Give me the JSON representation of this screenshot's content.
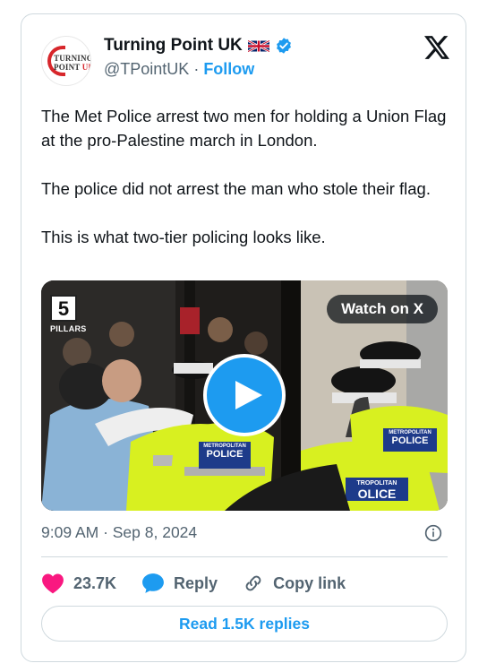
{
  "account": {
    "display_name": "Turning Point UK",
    "handle": "@TPointUK",
    "separator": "·",
    "follow_label": "Follow",
    "avatar_text_line1": "TURNING",
    "avatar_text_line2_a": "POINT",
    "avatar_text_line2_b": "UK"
  },
  "tweet": {
    "paragraphs": [
      "The Met Police arrest two men for holding a Union Flag at the pro-Palestine march in London.",
      "The police did not arrest the man who stole their flag.",
      "This is what two-tier policing looks like."
    ],
    "timestamp": "9:09 AM · Sep 8, 2024"
  },
  "media": {
    "watermark_number": "5",
    "watermark_text": "PILLARS",
    "watch_label": "Watch on X",
    "vest_text_1a": "METROPOLITAN",
    "vest_text_1b": "POLICE",
    "vest_text_2a": "METROPOLITAN",
    "vest_text_2b": "POLICE",
    "vest_text_3a": "TROPOLITAN",
    "vest_text_3b": "OLICE"
  },
  "actions": {
    "like_count": "23.7K",
    "reply_label": "Reply",
    "copy_label": "Copy link",
    "read_replies_label": "Read 1.5K replies"
  },
  "colors": {
    "accent": "#1d9bf0",
    "like": "#f91880",
    "text_primary": "#0f1419",
    "text_secondary": "#536471",
    "border": "#cfd9de"
  },
  "icons": [
    "uk-flag-icon",
    "verified-badge-icon",
    "x-logo-icon",
    "play-icon",
    "info-icon",
    "heart-icon",
    "reply-bubble-icon",
    "link-icon"
  ]
}
